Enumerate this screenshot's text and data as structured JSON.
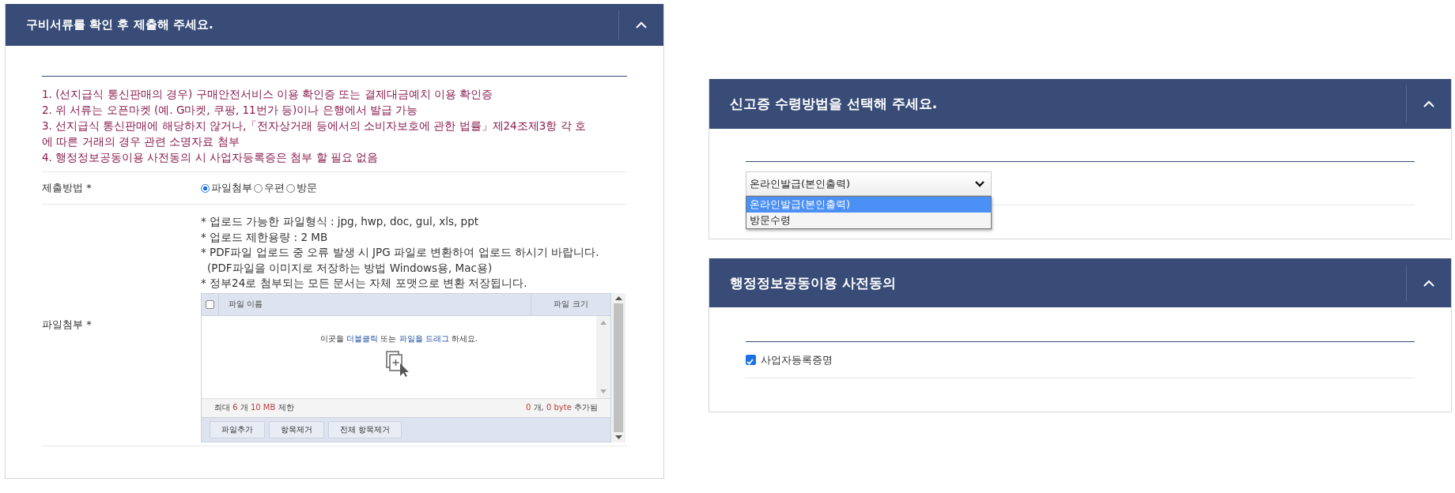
{
  "panels": [
    {
      "kind": "documents",
      "title": "구비서류를 확인 후 제출해 주세요.",
      "expanded": true,
      "notes": [
        "1. (선지급식 통신판매의 경우) 구매안전서비스 이용 확인증 또는 결제대금예치 이용 확인증",
        "2. 위 서류는 오픈마켓 (예. G마켓, 쿠팡, 11번가 등)이나 은행에서 발급 가능",
        "3. 선지급식 통신판매에 해당하지 않거나,「전자상거래 등에서의 소비자보호에 관한 법률」제24조제3항 각 호에 따른 거래의 경우 관련 소명자료 첨부",
        "4. 행정정보공동이용 사전동의 시 사업자등록증은 첨부 할 필요 없음"
      ],
      "submission": {
        "label": "제출방법 *",
        "options": [
          {
            "label": "파일첨부",
            "selected": true
          },
          {
            "label": "우편",
            "selected": false
          },
          {
            "label": "방문",
            "selected": false
          }
        ]
      },
      "attachment": {
        "label": "파일첨부 *",
        "guides": [
          "* 업로드 가능한 파일형식 : jpg, hwp, doc, gul, xls, ppt",
          "* 업로드 제한용량 : 2 MB",
          "* PDF파일 업로드 중 오류 발생 시 JPG 파일로 변환하여 업로드 하시기 바랍니다.",
          "(PDF파일을 이미지로 저장하는 방법  Windows용, Mac용)",
          "* 정부24로 첨부되는 모든 문서는 자체 포맷으로 변환 저장됩니다."
        ],
        "uploader": {
          "columns": [
            "파일 이름",
            "파일 크기"
          ],
          "select_all_checked": false,
          "drop_hint": "이곳을 **더블클릭** 또는 **파일을 드래그** 하세요.",
          "limit": "최대 **6** 개 **10 MB** 제한",
          "added": "**0** 개, **0 byte** 추가됨",
          "buttons": [
            "파일추가",
            "항목제거",
            "전체 항목제거"
          ]
        }
      }
    },
    {
      "kind": "receipt",
      "title": "신고증 수령방법을 선택해 주세요.",
      "expanded": true,
      "select": {
        "value": "온라인발급(본인출력)",
        "open": true,
        "options": [
          {
            "label": "온라인발급(본인출력)",
            "selected": true
          },
          {
            "label": "방문수령",
            "selected": false
          }
        ]
      }
    },
    {
      "kind": "consent",
      "title": "행정정보공동이용 사전동의",
      "expanded": true,
      "checkboxes": [
        {
          "label": "사업자등록증명",
          "checked": true
        }
      ]
    }
  ]
}
